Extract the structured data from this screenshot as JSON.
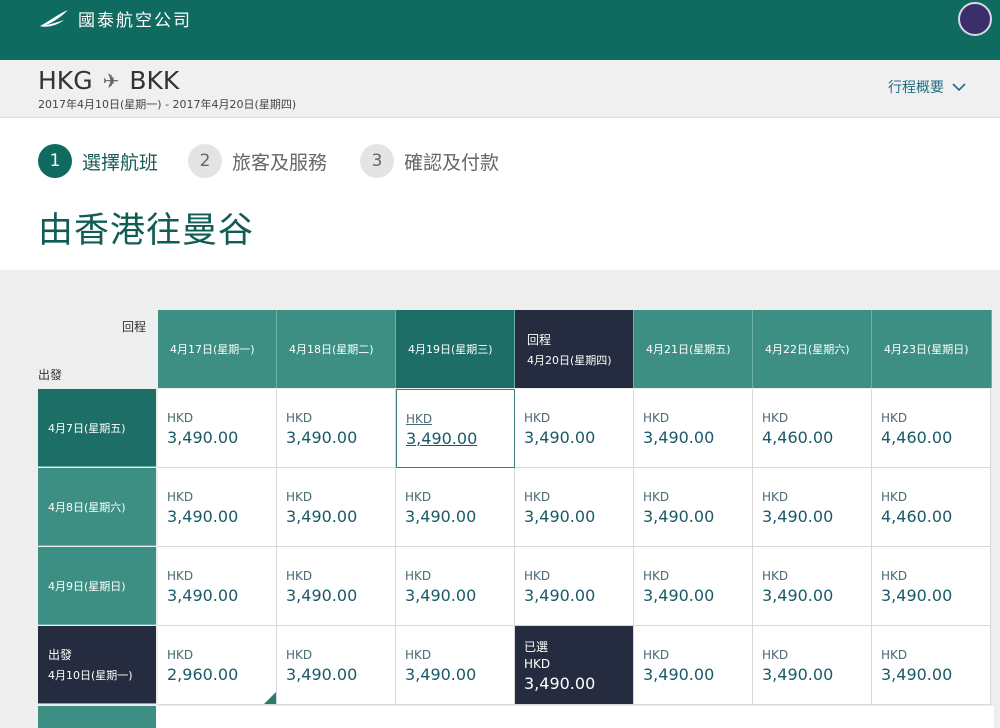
{
  "header": {
    "airline_name": "國泰航空公司",
    "colors": {
      "brand": "#0f6b60",
      "selected": "#262c3f"
    }
  },
  "route": {
    "origin": "HKG",
    "destination": "BKK",
    "plane_icon": "✈",
    "dates": "2017年4月10日(星期一) - 2017年4月20日(星期四)",
    "summary_label": "行程概要"
  },
  "steps": [
    {
      "number": "1",
      "label": "選擇航班",
      "active": true
    },
    {
      "number": "2",
      "label": "旅客及服務",
      "active": false
    },
    {
      "number": "3",
      "label": "確認及付款",
      "active": false
    }
  ],
  "page_title": "由香港往曼谷",
  "grid": {
    "return_axis_label": "回程",
    "depart_axis_label": "出發",
    "return_dates": [
      {
        "label": "4月17日(星期一)"
      },
      {
        "label": "4月18日(星期二)"
      },
      {
        "label": "4月19日(星期三)"
      },
      {
        "label": "4月20日(星期四)",
        "tag": "回程"
      },
      {
        "label": "4月21日(星期五)"
      },
      {
        "label": "4月22日(星期六)"
      },
      {
        "label": "4月23日(星期日)"
      }
    ],
    "depart_dates": [
      {
        "label": "4月7日(星期五)"
      },
      {
        "label": "4月8日(星期六)"
      },
      {
        "label": "4月9日(星期日)"
      },
      {
        "label": "4月10日(星期一)",
        "tag": "出發"
      }
    ],
    "currency": "HKD",
    "selected_label": "已選",
    "prices": [
      [
        "3,490.00",
        "3,490.00",
        "3,490.00",
        "3,490.00",
        "3,490.00",
        "4,460.00",
        "4,460.00"
      ],
      [
        "3,490.00",
        "3,490.00",
        "3,490.00",
        "3,490.00",
        "3,490.00",
        "3,490.00",
        "4,460.00"
      ],
      [
        "3,490.00",
        "3,490.00",
        "3,490.00",
        "3,490.00",
        "3,490.00",
        "3,490.00",
        "3,490.00"
      ],
      [
        "2,960.00",
        "3,490.00",
        "3,490.00",
        "3,490.00",
        "3,490.00",
        "3,490.00",
        "3,490.00"
      ]
    ]
  }
}
